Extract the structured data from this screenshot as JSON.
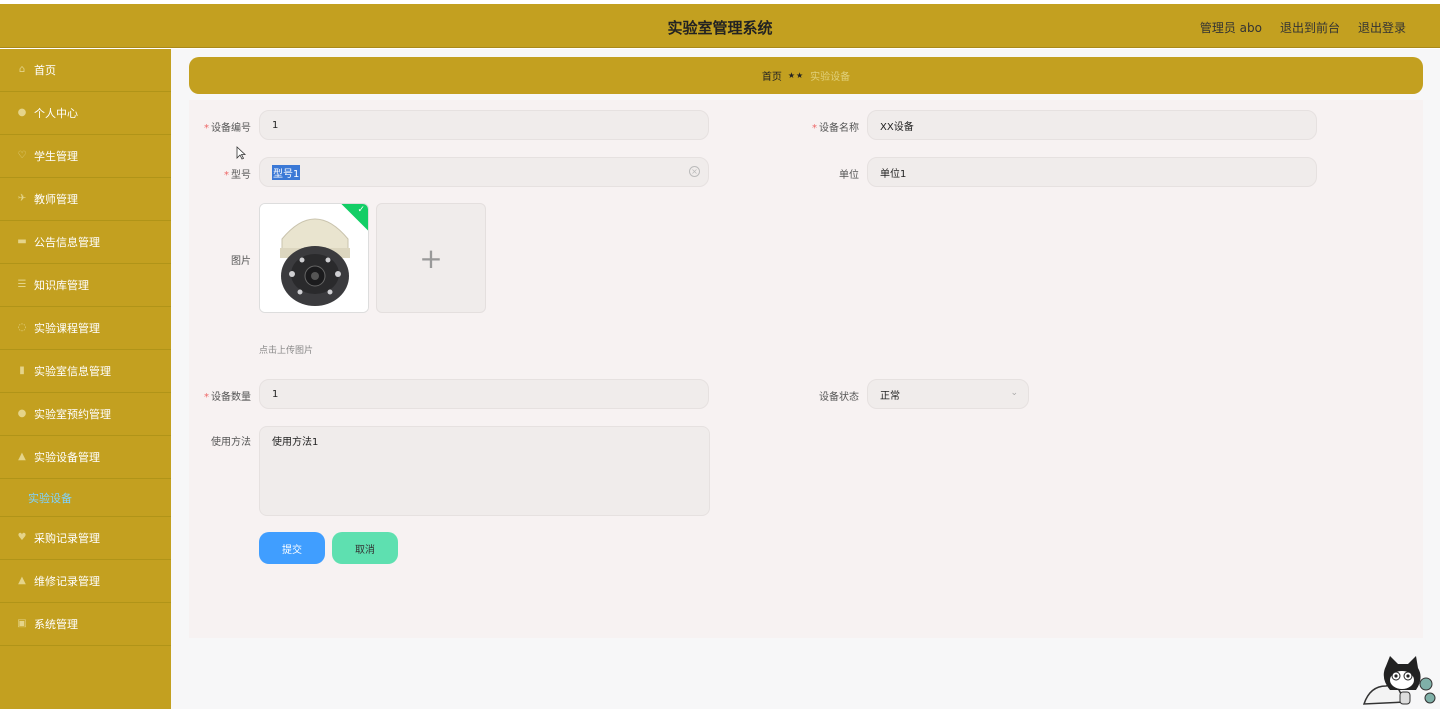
{
  "app": {
    "title": "实验室管理系统",
    "user": "管理员 abo",
    "back_to_front": "退出到前台",
    "logout": "退出登录"
  },
  "sidebar": {
    "items": [
      {
        "label": "首页",
        "icon": "home-icon"
      },
      {
        "label": "个人中心",
        "icon": "user-icon"
      },
      {
        "label": "学生管理",
        "icon": "student-icon"
      },
      {
        "label": "教师管理",
        "icon": "teacher-icon"
      },
      {
        "label": "公告信息管理",
        "icon": "notice-icon"
      },
      {
        "label": "知识库管理",
        "icon": "book-icon"
      },
      {
        "label": "实验课程管理",
        "icon": "course-icon"
      },
      {
        "label": "实验室信息管理",
        "icon": "chart-icon"
      },
      {
        "label": "实验室预约管理",
        "icon": "reserve-icon"
      },
      {
        "label": "实验设备管理",
        "icon": "device-icon"
      },
      {
        "label": "采购记录管理",
        "icon": "purchase-icon"
      },
      {
        "label": "维修记录管理",
        "icon": "repair-icon"
      },
      {
        "label": "系统管理",
        "icon": "settings-icon"
      }
    ],
    "active_sub": "实验设备"
  },
  "breadcrumb": {
    "home": "首页",
    "separator": "★★",
    "current": "实验设备"
  },
  "form": {
    "device_no_label": "设备编号",
    "device_no": "1",
    "device_name_label": "设备名称",
    "device_name": "XX设备",
    "model_label": "型号",
    "model": "型号1",
    "unit_label": "单位",
    "unit": "单位1",
    "image_label": "图片",
    "upload_hint": "点击上传图片",
    "quantity_label": "设备数量",
    "quantity": "1",
    "status_label": "设备状态",
    "status": "正常",
    "usage_label": "使用方法",
    "usage": "使用方法1",
    "submit": "提交",
    "cancel": "取消"
  }
}
